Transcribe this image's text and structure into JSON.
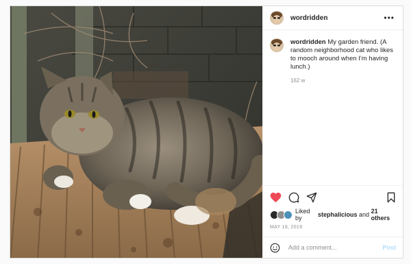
{
  "post": {
    "author": "wordridden",
    "caption": "My garden friend. (A random neighborhood cat who likes to mooch around when I'm having lunch.)",
    "age": "162 w",
    "likes": {
      "prefix": "Liked by",
      "user": "stephalicious",
      "joiner": "and",
      "others": "21 others"
    },
    "date": "MAY 18, 2019"
  },
  "comment": {
    "placeholder": "Add a comment...",
    "post_label": "Post"
  },
  "icons": {
    "header_more": "more-horizontal-icon",
    "like": "heart-icon",
    "comment": "comment-bubble-icon",
    "share": "paper-plane-icon",
    "save": "bookmark-icon",
    "emoji": "smiley-icon"
  },
  "colors": {
    "like_active": "#ed4956",
    "post_button_disabled": "#b2dffc",
    "secondary_text": "#8e8e8e"
  }
}
